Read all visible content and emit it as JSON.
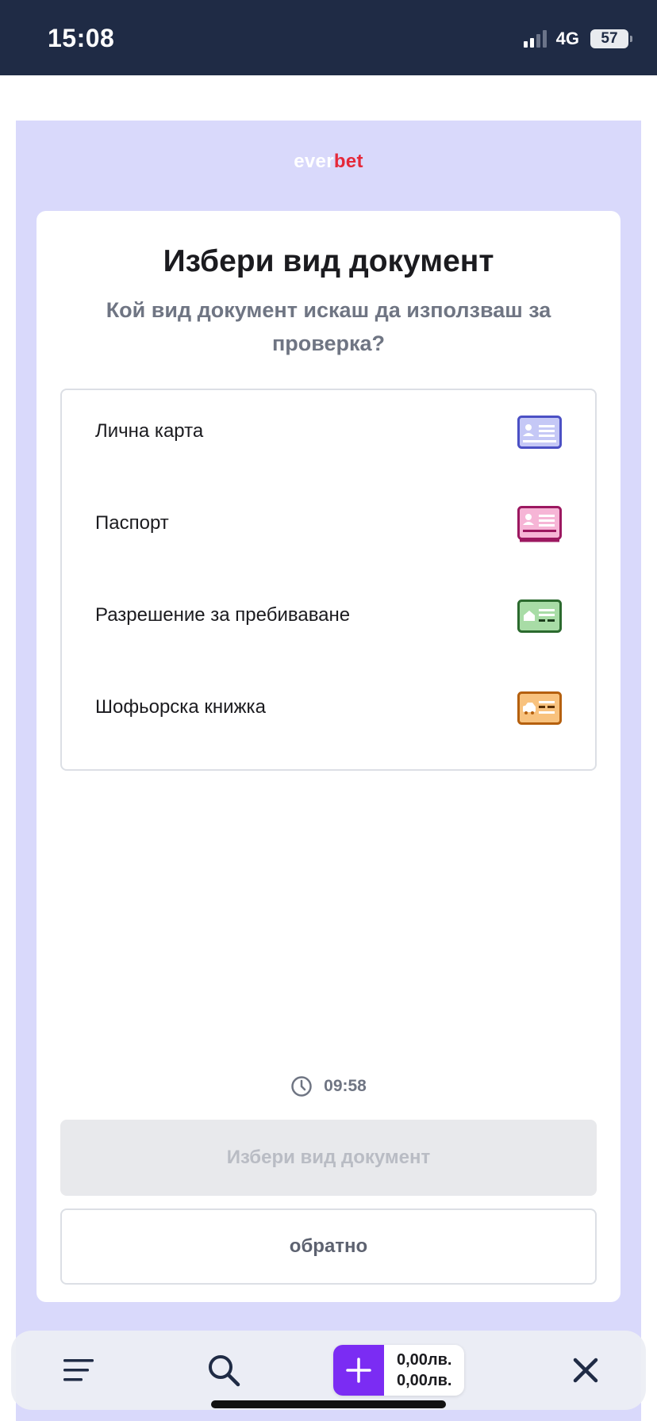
{
  "status_bar": {
    "time": "15:08",
    "network": "4G",
    "battery": "57"
  },
  "logo": {
    "part1": "ever",
    "part2": "bet"
  },
  "card": {
    "title": "Избери вид документ",
    "subtitle": "Кой вид документ искаш да използваш за проверка?"
  },
  "documents": [
    {
      "label": "Лична карта",
      "icon": "id-card-icon",
      "color": "#5a5fd0"
    },
    {
      "label": "Паспорт",
      "icon": "passport-icon",
      "color": "#b0206e"
    },
    {
      "label": "Разрешение за пребиваване",
      "icon": "residence-permit-icon",
      "color": "#2e7d32"
    },
    {
      "label": "Шофьорска книжка",
      "icon": "driving-license-icon",
      "color": "#c46a12"
    }
  ],
  "timer": {
    "value": "09:58"
  },
  "buttons": {
    "primary": "Избери вид документ",
    "secondary": "обратно"
  },
  "bottom_bar": {
    "betslip_amount_1": "0,00лв.",
    "betslip_amount_2": "0,00лв.",
    "accent": "#7b2cf3"
  }
}
